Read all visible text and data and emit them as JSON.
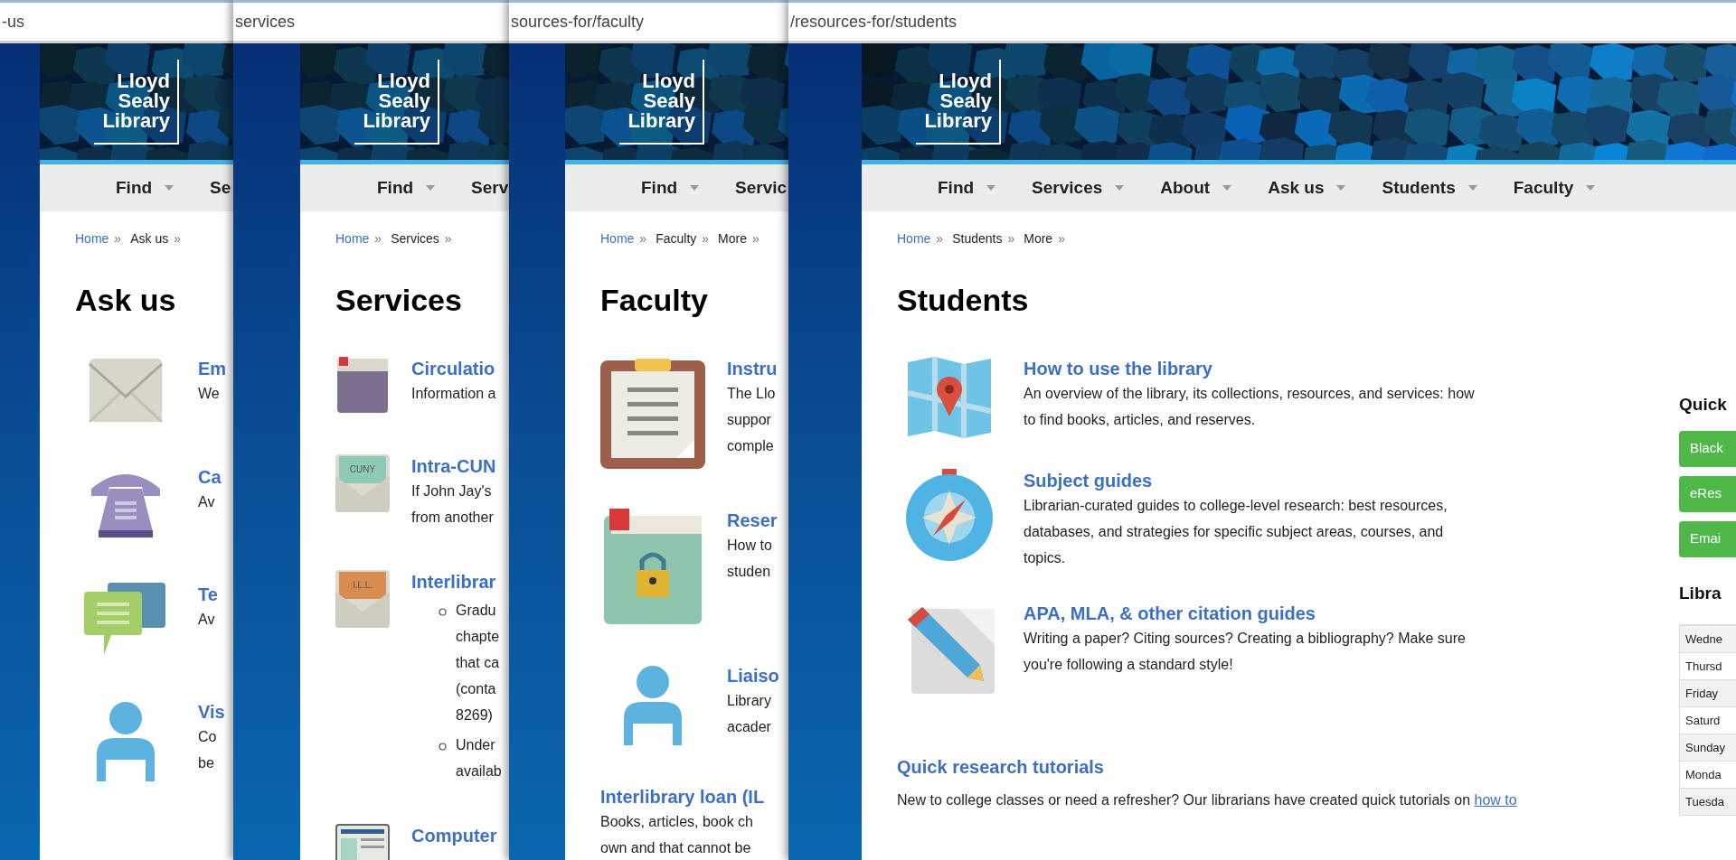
{
  "windows": [
    {
      "url": "-us",
      "logo": [
        "Lloyd",
        "Sealy",
        "Library"
      ],
      "nav": [
        {
          "label": "Find",
          "caret": true
        },
        {
          "label": "Se",
          "caret": false
        }
      ],
      "breadcrumb": [
        {
          "text": "Home",
          "link": true,
          "sep": "»"
        },
        {
          "text": "Ask us",
          "link": false,
          "sep": "»"
        }
      ],
      "title": "Ask us",
      "items": [
        {
          "kind": "envelope",
          "title": "Em",
          "lines": [
            "We"
          ]
        },
        {
          "kind": "phone",
          "title": "Ca",
          "lines": [
            "Av"
          ]
        },
        {
          "kind": "chat",
          "title": "Te",
          "lines": [
            "Av"
          ]
        },
        {
          "kind": "person",
          "title": "Vis",
          "lines": [
            "Co",
            "be"
          ]
        }
      ]
    },
    {
      "url": "services",
      "logo": [
        "Lloyd",
        "Sealy",
        "Library"
      ],
      "nav": [
        {
          "label": "Find",
          "caret": true
        },
        {
          "label": "Serv",
          "caret": false
        }
      ],
      "breadcrumb": [
        {
          "text": "Home",
          "link": true,
          "sep": "»"
        },
        {
          "text": "Services",
          "link": false,
          "sep": "»"
        }
      ],
      "title": "Services",
      "items": [
        {
          "kind": "folder",
          "title": "Circulatio",
          "lines": [
            "Information a"
          ]
        },
        {
          "kind": "mail",
          "badge": "CUNY",
          "title": "Intra-CUN",
          "lines": [
            "If John Jay's",
            "from another"
          ]
        },
        {
          "kind": "mail-orange",
          "badge": "I.L.L.",
          "title": "Interlibrar",
          "bullets": [
            [
              "Gradu",
              "chapte",
              "that ca",
              "(conta",
              "8269)"
            ],
            [
              "Under",
              "availab"
            ]
          ]
        },
        {
          "kind": "screen",
          "title": "Computer"
        }
      ]
    },
    {
      "url": "sources-for/faculty",
      "logo": [
        "Lloyd",
        "Sealy",
        "Library"
      ],
      "nav": [
        {
          "label": "Find",
          "caret": true
        },
        {
          "label": "Servic",
          "caret": false
        }
      ],
      "breadcrumb": [
        {
          "text": "Home",
          "link": true,
          "sep": "»"
        },
        {
          "text": "Faculty",
          "link": false,
          "sep": "»"
        },
        {
          "text": "More",
          "link": false,
          "sep": "»"
        }
      ],
      "title": "Faculty",
      "items": [
        {
          "kind": "clipboard",
          "title": "Instru",
          "lines": [
            "The Llo",
            "suppor",
            "comple"
          ]
        },
        {
          "kind": "book-lock",
          "title": "Reser",
          "lines": [
            "How to",
            "studen"
          ]
        },
        {
          "kind": "person",
          "title": "Liaiso",
          "lines": [
            "Library",
            "acader"
          ]
        },
        {
          "kind": "section",
          "title": "Interlibrary loan (IL",
          "lines": [
            "Books, articles, book ch",
            "own and that cannot be"
          ]
        }
      ]
    },
    {
      "url": "/resources-for/students",
      "logo": [
        "Lloyd",
        "Sealy",
        "Library"
      ],
      "nav": [
        {
          "label": "Find",
          "caret": true
        },
        {
          "label": "Services",
          "caret": true
        },
        {
          "label": "About",
          "caret": true
        },
        {
          "label": "Ask us",
          "caret": true
        },
        {
          "label": "Students",
          "caret": true
        },
        {
          "label": "Faculty",
          "caret": true
        }
      ],
      "breadcrumb": [
        {
          "text": "Home",
          "link": true,
          "sep": "»"
        },
        {
          "text": "Students",
          "link": false,
          "sep": "»"
        },
        {
          "text": "More",
          "link": false,
          "sep": "»"
        }
      ],
      "title": "Students",
      "items": [
        {
          "kind": "map",
          "title": "How to use the library",
          "lines": [
            "An overview of the library, its collections, resources, and services: how",
            "to find books, articles, and reserves."
          ]
        },
        {
          "kind": "compass",
          "title": "Subject guides",
          "lines": [
            "Librarian-curated guides to college-level research: best resources,",
            "databases, and strategies for specific subject areas, courses, and",
            "topics."
          ]
        },
        {
          "kind": "pencil",
          "title": "APA, MLA, & other citation guides",
          "lines": [
            "Writing a paper? Citing sources? Creating a bibliography? Make sure",
            "you're following a standard style!"
          ]
        }
      ],
      "tutorials": {
        "title": "Quick research tutorials",
        "text": "New to college classes or need a refresher? Our librarians have created quick tutorials on",
        "link": "how to"
      },
      "sidebar": {
        "heading": "Quick",
        "buttons": [
          "Black",
          "eRes",
          "Emai"
        ],
        "hours_heading": "Libra",
        "hours": [
          "Wedne",
          "Thursd",
          "Friday",
          "Saturd",
          "Sunday",
          "Monda",
          "Tuesda"
        ]
      }
    }
  ]
}
